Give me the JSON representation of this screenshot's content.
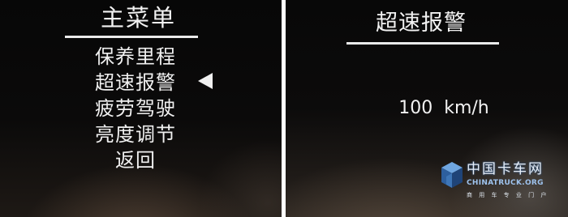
{
  "main_menu": {
    "title": "主菜单",
    "items": [
      {
        "label": "保养里程"
      },
      {
        "label": "超速报警",
        "selected": true
      },
      {
        "label": "疲劳驾驶"
      },
      {
        "label": "亮度调节"
      },
      {
        "label": "返回"
      }
    ]
  },
  "speed_alarm": {
    "title": "超速报警",
    "value": "100  km/h"
  },
  "watermark": {
    "logo_icon": "cube-icon",
    "chinese": "中国卡车网",
    "english": "CHINATRUCK.ORG",
    "tagline": "商 用 车 专 业 门 户"
  },
  "colors": {
    "text": "#f0f0f0",
    "background": "#0a0a0a",
    "watermark_blue": "#3a6fb0"
  }
}
